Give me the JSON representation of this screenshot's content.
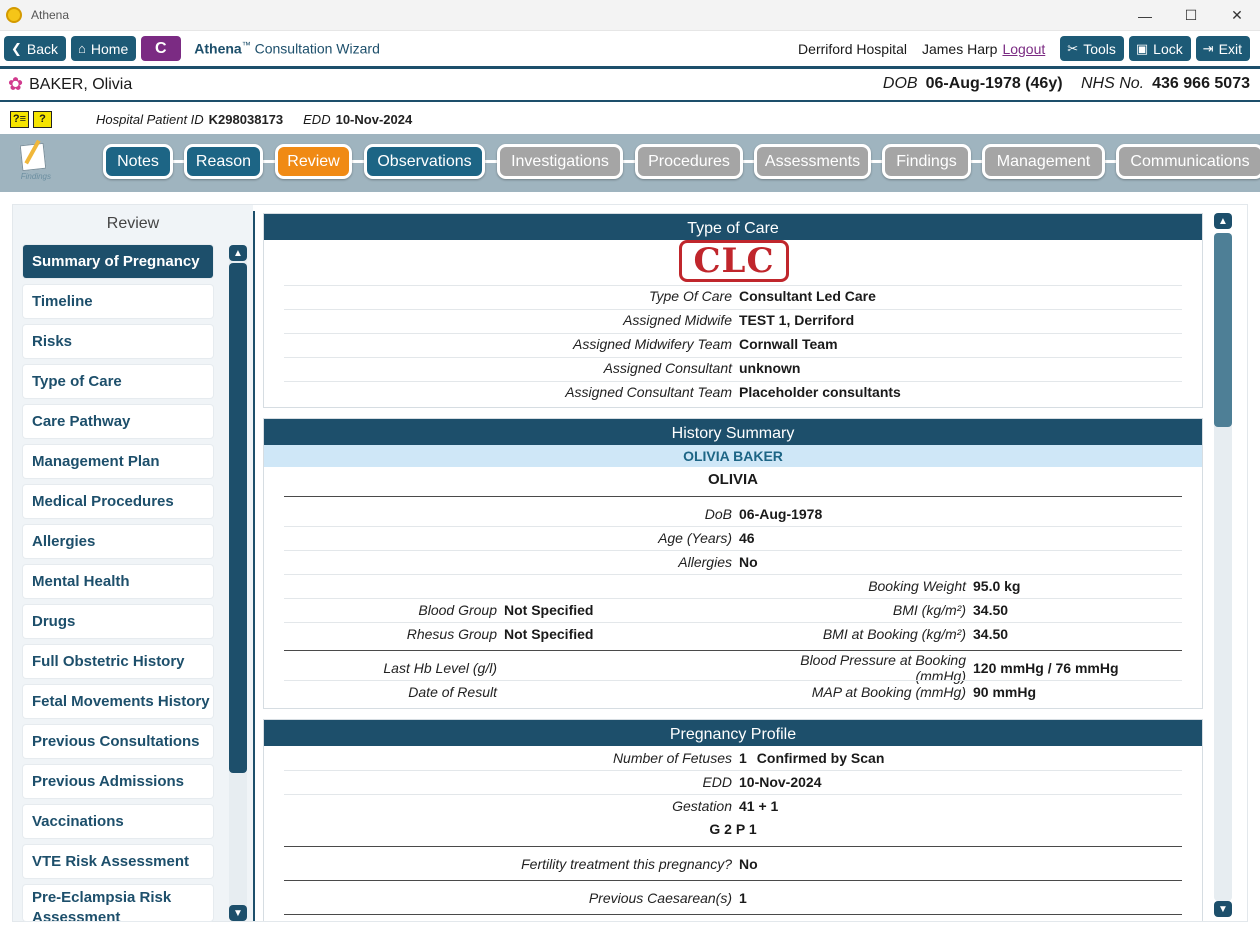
{
  "window": {
    "title": "Athena",
    "min": "—",
    "max": "☐",
    "close": "✕"
  },
  "toolbar": {
    "back": "Back",
    "home": "Home",
    "c_button": "C",
    "wizard_brand": "Athena",
    "wizard_tm": "™",
    "wizard_title": "Consultation Wizard",
    "hospital": "Derriford Hospital",
    "user": "James Harp",
    "logout": "Logout",
    "tools": "Tools",
    "lock": "Lock",
    "exit": "Exit"
  },
  "patient": {
    "name": "BAKER, Olivia",
    "dob_label": "DOB",
    "dob_value": "06-Aug-1978 (46y)",
    "nhs_label": "NHS No.",
    "nhs_value": "436 966 5073",
    "hosp_id_label": "Hospital Patient ID",
    "hosp_id_value": "K298038173",
    "edd_label": "EDD",
    "edd_value": "10-Nov-2024",
    "badge1": "?≡",
    "badge2": "?"
  },
  "findings_icon_label": "Findings",
  "tabs": [
    {
      "label": "Notes",
      "state": "active"
    },
    {
      "label": "Reason",
      "state": "active"
    },
    {
      "label": "Review",
      "state": "current"
    },
    {
      "label": "Observations",
      "state": "active"
    },
    {
      "label": "Investigations",
      "state": "disabled"
    },
    {
      "label": "Procedures",
      "state": "disabled"
    },
    {
      "label": "Assessments",
      "state": "disabled"
    },
    {
      "label": "Findings",
      "state": "disabled"
    },
    {
      "label": "Management",
      "state": "disabled"
    },
    {
      "label": "Communications",
      "state": "disabled"
    }
  ],
  "nav": {
    "title": "Review",
    "items": [
      "Summary of Pregnancy",
      "Timeline",
      "Risks",
      "Type of Care",
      "Care Pathway",
      "Management Plan",
      "Medical Procedures",
      "Allergies",
      "Mental Health",
      "Drugs",
      "Full Obstetric History",
      "Fetal Movements History",
      "Previous Consultations",
      "Previous Admissions",
      "Vaccinations",
      "VTE Risk Assessment"
    ],
    "last_item_line1": "Pre-Eclampsia Risk",
    "last_item_line2": "Assessment"
  },
  "type_of_care": {
    "title": "Type of Care",
    "stamp": "CLC",
    "rows": [
      {
        "label": "Type Of Care",
        "value": "Consultant Led Care"
      },
      {
        "label": "Assigned Midwife",
        "value": "TEST 1, Derriford"
      },
      {
        "label": "Assigned Midwifery Team",
        "value": "Cornwall Team"
      },
      {
        "label": "Assigned Consultant",
        "value": "unknown"
      },
      {
        "label": "Assigned Consultant Team",
        "value": "Placeholder consultants"
      }
    ]
  },
  "history": {
    "title": "History Summary",
    "band": "OLIVIA BAKER",
    "first_name": "OLIVIA",
    "dob_label": "DoB",
    "dob_value": "06-Aug-1978",
    "age_label": "Age (Years)",
    "age_value": "46",
    "allergies_label": "Allergies",
    "allergies_value": "No",
    "weight_label": "Booking Weight",
    "weight_value": "95.0 kg",
    "blood_label": "Blood Group",
    "blood_value": "Not Specified",
    "bmi_label": "BMI (kg/m²)",
    "bmi_value": "34.50",
    "rhesus_label": "Rhesus Group",
    "rhesus_value": "Not Specified",
    "bmi_booking_label": "BMI at Booking (kg/m²)",
    "bmi_booking_value": "34.50",
    "hb_label": "Last Hb Level (g/l)",
    "bp_label": "Blood Pressure at Booking (mmHg)",
    "bp_value": "120 mmHg / 76 mmHg",
    "date_result_label": "Date of Result",
    "map_label": "MAP at Booking (mmHg)",
    "map_value": "90 mmHg"
  },
  "pregnancy": {
    "title": "Pregnancy Profile",
    "fetuses_label": "Number of Fetuses",
    "fetuses_value": "1",
    "fetuses_note": "Confirmed by Scan",
    "edd_label": "EDD",
    "edd_value": "10-Nov-2024",
    "gestation_label": "Gestation",
    "gestation_value": "41 + 1",
    "gp": "G 2 P 1",
    "fertility_label": "Fertility treatment this pregnancy?",
    "fertility_value": "No",
    "caesarean_label": "Previous Caesarean(s)",
    "caesarean_value": "1"
  }
}
